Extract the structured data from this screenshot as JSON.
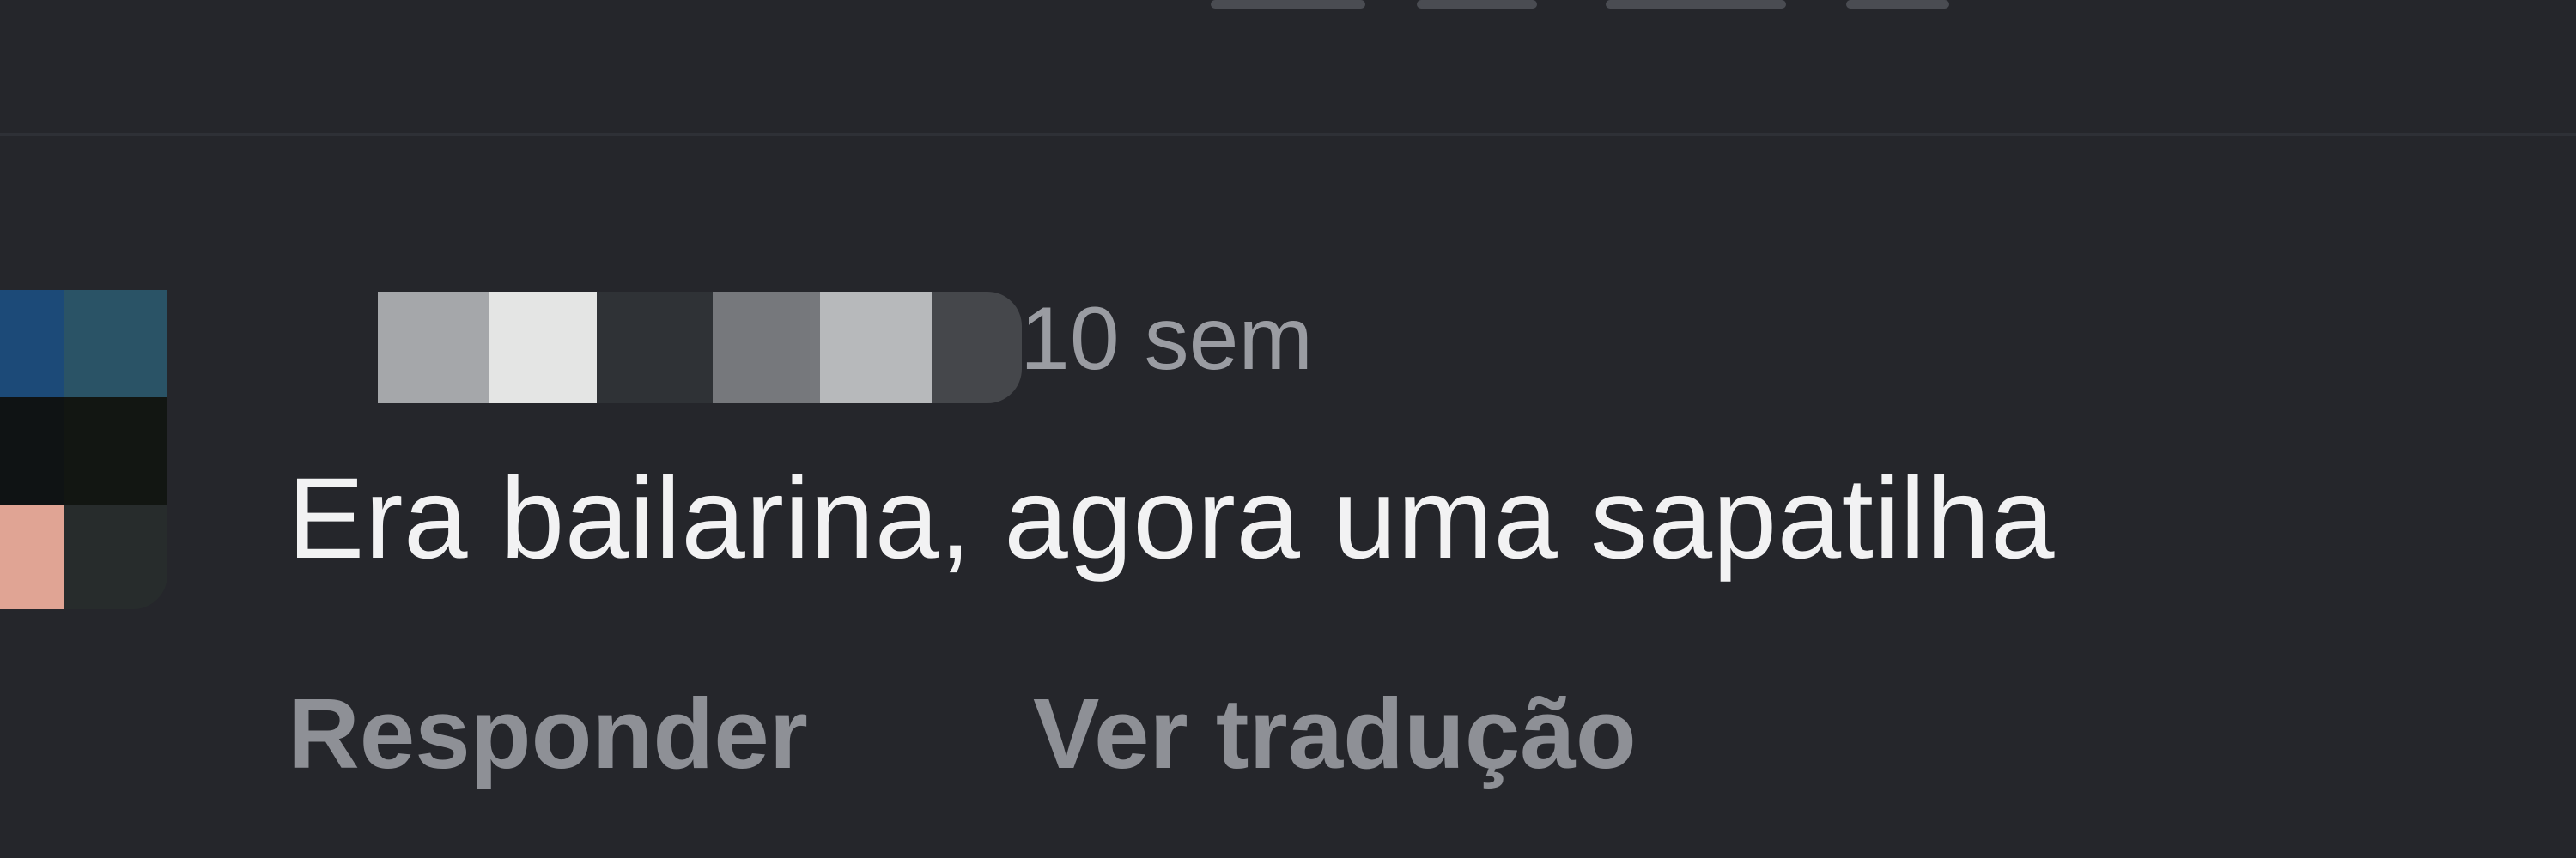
{
  "comment": {
    "timestamp": "10 sem",
    "text": "Era bailarina, agora uma sapatilha",
    "actions": {
      "reply_label": "Responder",
      "translate_label": "Ver tradução"
    }
  },
  "colors": {
    "background": "#25262b",
    "comment_text": "#f2f2f3",
    "secondary_text": "#8e9096"
  }
}
